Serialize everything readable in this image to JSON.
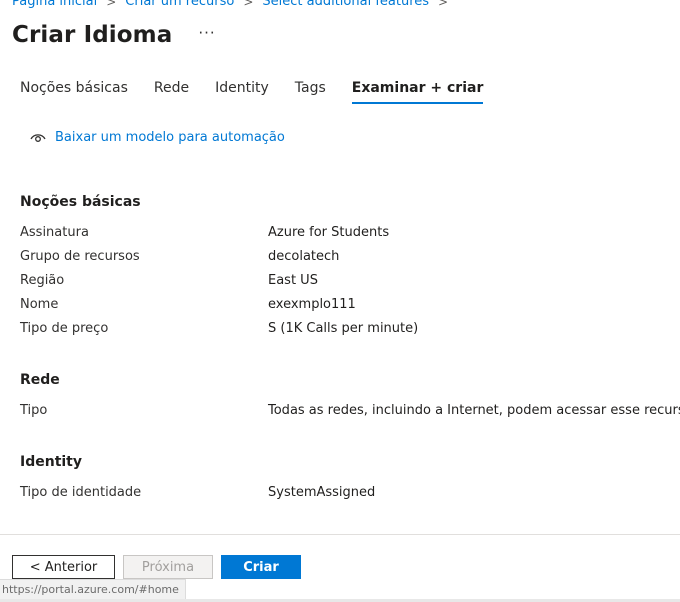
{
  "breadcrumb": {
    "items": [
      "Página inicial",
      "Criar um recurso",
      "Select additional features"
    ]
  },
  "page": {
    "title": "Criar Idioma",
    "more_label": "···"
  },
  "tabs": [
    {
      "label": "Noções básicas",
      "active": false
    },
    {
      "label": "Rede",
      "active": false
    },
    {
      "label": "Identity",
      "active": false
    },
    {
      "label": "Tags",
      "active": false
    },
    {
      "label": "Examinar + criar",
      "active": true
    }
  ],
  "download_link": {
    "label": "Baixar um modelo para automação",
    "icon": "eye-icon"
  },
  "sections": {
    "basics": {
      "title": "Noções básicas",
      "rows": [
        {
          "label": "Assinatura",
          "value": "Azure for Students"
        },
        {
          "label": "Grupo de recursos",
          "value": "decolatech"
        },
        {
          "label": "Região",
          "value": "East US"
        },
        {
          "label": "Nome",
          "value": "exexmplo111"
        },
        {
          "label": "Tipo de preço",
          "value": "S (1K Calls per minute)"
        }
      ]
    },
    "network": {
      "title": "Rede",
      "rows": [
        {
          "label": "Tipo",
          "value": "Todas as redes, incluindo a Internet, podem acessar esse recurso."
        }
      ]
    },
    "identity": {
      "title": "Identity",
      "rows": [
        {
          "label": "Tipo de identidade",
          "value": "SystemAssigned"
        }
      ]
    }
  },
  "footer": {
    "prev_label": "< Anterior",
    "next_label": "Próxima",
    "create_label": "Criar"
  },
  "status_bar": {
    "url": "https://portal.azure.com/#home"
  },
  "colors": {
    "accent": "#0078d4",
    "text": "#323130",
    "disabled_bg": "#f3f2f1"
  }
}
